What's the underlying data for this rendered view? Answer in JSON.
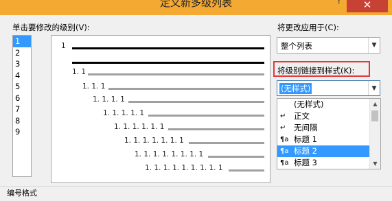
{
  "window": {
    "title": "定义新多级列表",
    "help": "?",
    "close": "✕"
  },
  "level_section": {
    "label": "单击要修改的级别(V):",
    "levels": [
      "1",
      "2",
      "3",
      "4",
      "5",
      "6",
      "7",
      "8",
      "9"
    ],
    "selected": "1"
  },
  "preview": {
    "numbers": [
      "1",
      "1. 1",
      "1. 1. 1",
      "1. 1. 1. 1",
      "1. 1. 1. 1. 1",
      "1. 1. 1. 1. 1. 1",
      "1. 1. 1. 1. 1. 1. 1",
      "1. 1. 1. 1. 1. 1. 1. 1",
      "1. 1. 1. 1. 1. 1. 1. 1. 1"
    ]
  },
  "apply_to": {
    "label": "将更改应用于(C):",
    "value": "整个列表"
  },
  "link_style": {
    "label": "将级别链接到样式(K):",
    "value": "(无样式)",
    "highlight_color": "#e8353a",
    "options": [
      {
        "text": "(无样式)",
        "icon": "",
        "selected": false
      },
      {
        "text": "正文",
        "icon": "↵",
        "selected": false
      },
      {
        "text": "无间隔",
        "icon": "↵",
        "selected": false
      },
      {
        "text": "标题 1",
        "icon": "¶a",
        "selected": false
      },
      {
        "text": "标题 2",
        "icon": "¶a",
        "selected": true
      },
      {
        "text": "标题 3",
        "icon": "¶a",
        "selected": false
      }
    ]
  },
  "number_format": {
    "label": "编号格式"
  },
  "colors": {
    "titlebar": "#f4a933",
    "close": "#c74135",
    "selection": "#3399ff"
  }
}
